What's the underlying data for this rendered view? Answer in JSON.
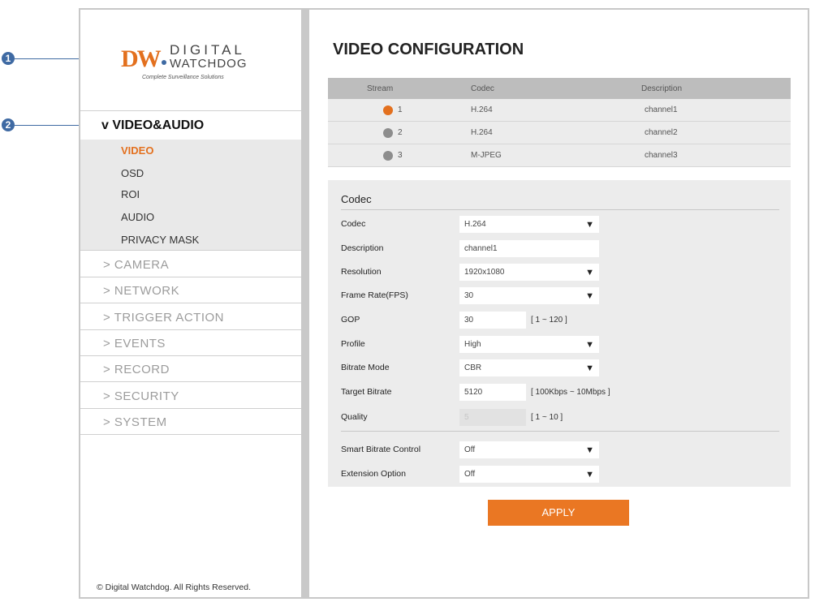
{
  "callouts": [
    "1",
    "2"
  ],
  "logo": {
    "mark": "DW",
    "line1": "DIGITAL",
    "line2": "WATCHDOG",
    "tagline": "Complete Surveillance Solutions",
    "brand_color": "#e3701e"
  },
  "sidebar": {
    "section": {
      "label": "v VIDEO&AUDIO",
      "items": [
        {
          "label": "VIDEO",
          "active": true
        },
        {
          "label": "OSD"
        },
        {
          "label": "ROI"
        },
        {
          "label": "AUDIO"
        },
        {
          "label": "PRIVACY MASK"
        }
      ]
    },
    "menu": [
      {
        "label": "> CAMERA"
      },
      {
        "label": "> NETWORK"
      },
      {
        "label": "> TRIGGER ACTION"
      },
      {
        "label": "> EVENTS"
      },
      {
        "label": "> RECORD"
      },
      {
        "label": "> SECURITY"
      },
      {
        "label": "> SYSTEM"
      }
    ],
    "copyright": "© Digital Watchdog. All Rights Reserved."
  },
  "main": {
    "title": "VIDEO CONFIGURATION",
    "stream_table": {
      "headers": [
        "Stream",
        "Codec",
        "Description"
      ],
      "rows": [
        {
          "stream": "1",
          "codec": "H.264",
          "description": "channel1",
          "selected": true
        },
        {
          "stream": "2",
          "codec": "H.264",
          "description": "channel2",
          "selected": false
        },
        {
          "stream": "3",
          "codec": "M-JPEG",
          "description": "channel3",
          "selected": false
        }
      ]
    },
    "codec_panel": {
      "title": "Codec",
      "fields": {
        "codec": {
          "label": "Codec",
          "value": "H.264"
        },
        "description": {
          "label": "Description",
          "value": "channel1"
        },
        "resolution": {
          "label": "Resolution",
          "value": "1920x1080"
        },
        "frame_rate": {
          "label": "Frame Rate(FPS)",
          "value": "30"
        },
        "gop": {
          "label": "GOP",
          "value": "30",
          "range": "[ 1 ~ 120 ]"
        },
        "profile": {
          "label": "Profile",
          "value": "High"
        },
        "bitrate_mode": {
          "label": "Bitrate Mode",
          "value": "CBR"
        },
        "target_bitrate": {
          "label": "Target Bitrate",
          "value": "5120",
          "range": "[ 100Kbps ~ 10Mbps ]"
        },
        "quality": {
          "label": "Quality",
          "value": "5",
          "range": "[ 1 ~ 10 ]"
        },
        "smart_bitrate": {
          "label": "Smart Bitrate Control",
          "value": "Off"
        },
        "extension_option": {
          "label": "Extension Option",
          "value": "Off"
        }
      },
      "dropdown_arrow": "▼"
    },
    "apply_label": "APPLY"
  }
}
